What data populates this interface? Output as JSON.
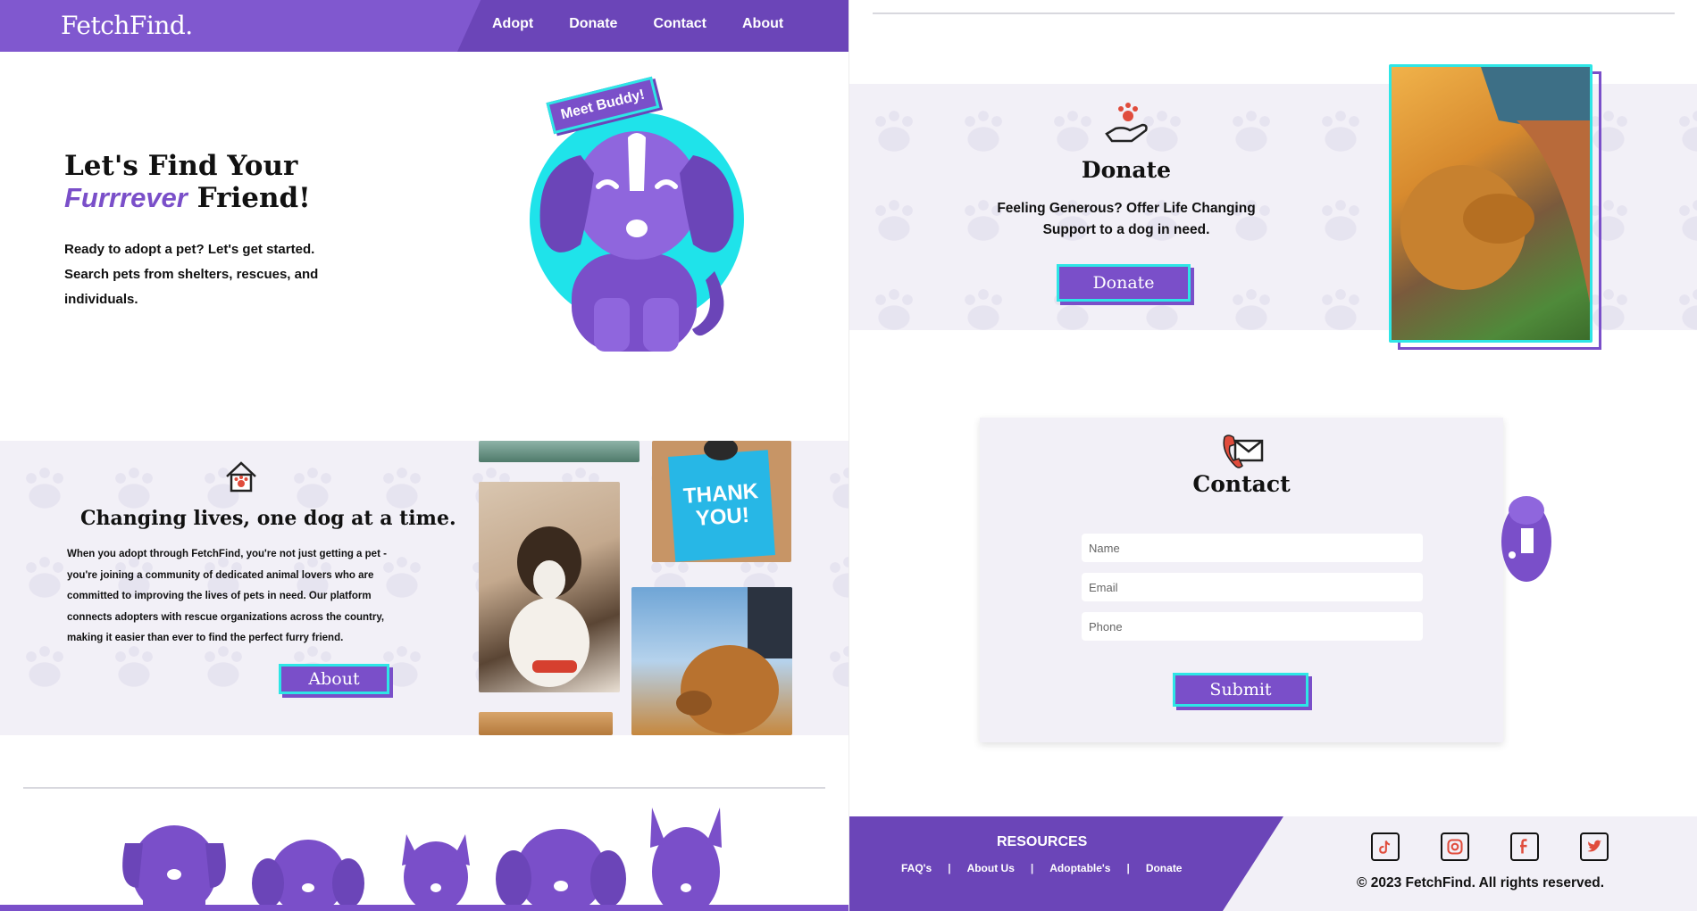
{
  "nav": {
    "brand": "FetchFind.",
    "links": [
      "Adopt",
      "Donate",
      "Contact",
      "About"
    ]
  },
  "hero": {
    "title_line1": "Let's Find Your",
    "title_emph": "Furrrever",
    "title_rest": "Friend!",
    "body": "Ready to adopt a pet? Let's get started. Search pets from shelters, rescues, and individuals.",
    "badge": "Meet Buddy!"
  },
  "about": {
    "title": "Changing lives, one dog at a time.",
    "body": "When you adopt through FetchFind, you're not just getting a pet - you're joining a community of dedicated animal lovers who are committed to improving the lives of pets in need. Our platform connects adopters with rescue organizations across the country, making it easier than ever to find the perfect furry friend.",
    "button": "About",
    "thank_you_text": "THANK YOU!"
  },
  "donate": {
    "title": "Donate",
    "body": "Feeling Generous? Offer Life Changing Support to a dog in need.",
    "button": "Donate"
  },
  "contact": {
    "title": "Contact",
    "name_placeholder": "Name",
    "email_placeholder": "Email",
    "phone_placeholder": "Phone",
    "submit": "Submit"
  },
  "footer": {
    "resources_title": "RESOURCES",
    "links": [
      "FAQ's",
      "About Us",
      "Adoptable's",
      "Donate"
    ],
    "separator": "|",
    "social": [
      "tiktok-icon",
      "instagram-icon",
      "facebook-icon",
      "twitter-icon"
    ],
    "copyright": "© 2023 FetchFind. All rights reserved."
  },
  "colors": {
    "primary": "#7a4fc9",
    "primary_dark": "#6b45b8",
    "accent": "#2ee6e6",
    "light_bg": "#f2f0f7",
    "icon_red": "#e04c3c"
  }
}
